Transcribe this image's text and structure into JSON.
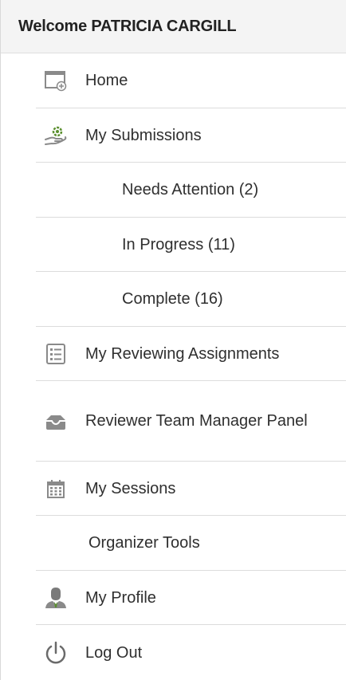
{
  "header": {
    "welcome": "Welcome PATRICIA CARGILL"
  },
  "menu": {
    "home": "Home",
    "my_submissions": "My Submissions",
    "needs_attention": "Needs Attention (2)",
    "in_progress": "In Progress (11)",
    "complete": "Complete (16)",
    "my_reviewing_assignments": "My Reviewing Assignments",
    "reviewer_team_manager_panel": "Reviewer Team Manager Panel",
    "my_sessions": "My Sessions",
    "organizer_tools": "Organizer Tools",
    "my_profile": "My Profile",
    "log_out": "Log Out"
  },
  "icons": {
    "home": "home-window-icon",
    "my_submissions": "hand-gear-icon",
    "my_reviewing_assignments": "checklist-icon",
    "reviewer_team_manager_panel": "inbox-tray-icon",
    "my_sessions": "calendar-icon",
    "my_profile": "user-icon",
    "log_out": "power-icon"
  },
  "colors": {
    "header_bg": "#f4f4f4",
    "divider": "#dcdcdc",
    "icon_gray": "#8a8a8a",
    "icon_green": "#5a8f2e"
  }
}
